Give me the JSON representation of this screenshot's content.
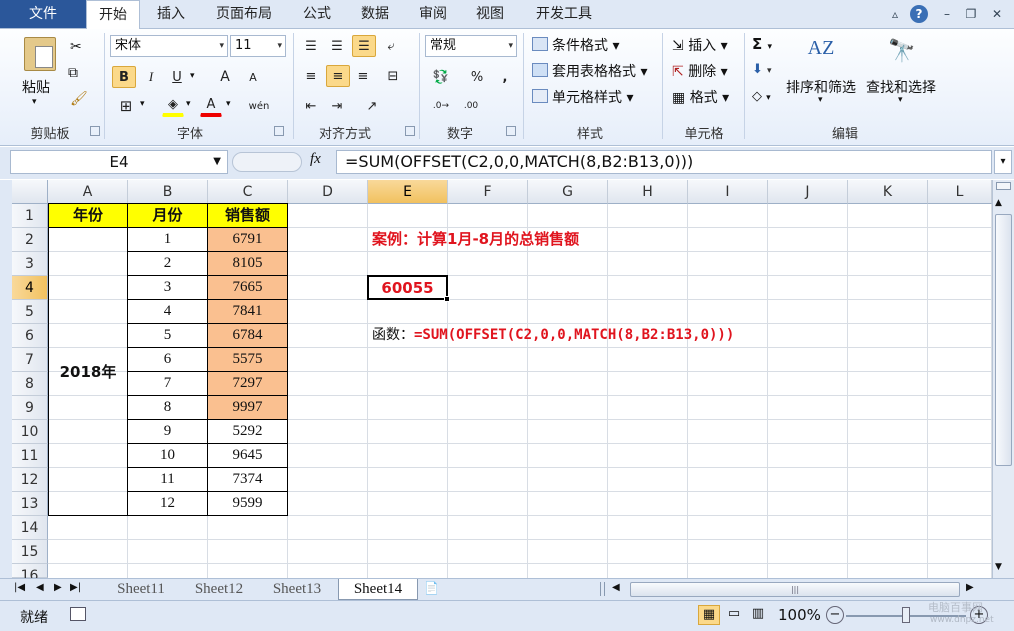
{
  "tabs": {
    "file": "文件",
    "home": "开始",
    "insert": "插入",
    "layout": "页面布局",
    "formulas": "公式",
    "data": "数据",
    "review": "审阅",
    "view": "视图",
    "developer": "开发工具"
  },
  "ribbon": {
    "clipboard": {
      "paste": "粘贴",
      "label": "剪贴板"
    },
    "font": {
      "name": "宋体",
      "size": "11",
      "label": "字体",
      "bold": "B",
      "italic": "I",
      "underline": "U",
      "grow": "A",
      "shrink": "A",
      "color": "A",
      "phonetic": "wén"
    },
    "alignment": {
      "label": "对齐方式"
    },
    "number": {
      "format": "常规",
      "percent": "%",
      "comma": ",",
      "label": "数字"
    },
    "styles": {
      "conditional": "条件格式",
      "table": "套用表格格式",
      "cell": "单元格样式",
      "label": "样式"
    },
    "cells": {
      "insert": "插入",
      "delete": "删除",
      "format": "格式",
      "label": "单元格"
    },
    "editing": {
      "sort": "排序和筛选",
      "find": "查找和选择",
      "label": "编辑",
      "sum": "Σ"
    }
  },
  "formula_bar": {
    "name_box": "E4",
    "fx": "fx",
    "formula": "=SUM(OFFSET(C2,0,0,MATCH(8,B2:B13,0)))"
  },
  "columns": [
    "A",
    "B",
    "C",
    "D",
    "E",
    "F",
    "G",
    "H",
    "I",
    "J",
    "K",
    "L"
  ],
  "rows": [
    "1",
    "2",
    "3",
    "4",
    "5",
    "6",
    "7",
    "8",
    "9",
    "10",
    "11",
    "12",
    "13",
    "14",
    "15",
    "16"
  ],
  "table": {
    "headers": [
      "年份",
      "月份",
      "销售额"
    ],
    "year": "2018年",
    "months": [
      "1",
      "2",
      "3",
      "4",
      "5",
      "6",
      "7",
      "8",
      "9",
      "10",
      "11",
      "12"
    ],
    "sales": [
      "6791",
      "8105",
      "7665",
      "7841",
      "6784",
      "5575",
      "7297",
      "9997",
      "5292",
      "9645",
      "7374",
      "9599"
    ]
  },
  "case_title": "案例：计算1月-8月的总销售额",
  "result": "60055",
  "func_label": "函数：",
  "func_text": "=SUM(OFFSET(C2,0,0,MATCH(8,B2:B13,0)))",
  "sheets": [
    "Sheet11",
    "Sheet12",
    "Sheet13",
    "Sheet14"
  ],
  "status": {
    "ready": "就绪",
    "zoom": "100%",
    "watermark": "电脑百事网",
    "watermark_url": "www.dnpz.net"
  },
  "colors": {
    "header_yellow": "#ffff00",
    "highlight_orange": "#fac090",
    "red_text": "#e0141e",
    "file_tab": "#2b579a"
  }
}
